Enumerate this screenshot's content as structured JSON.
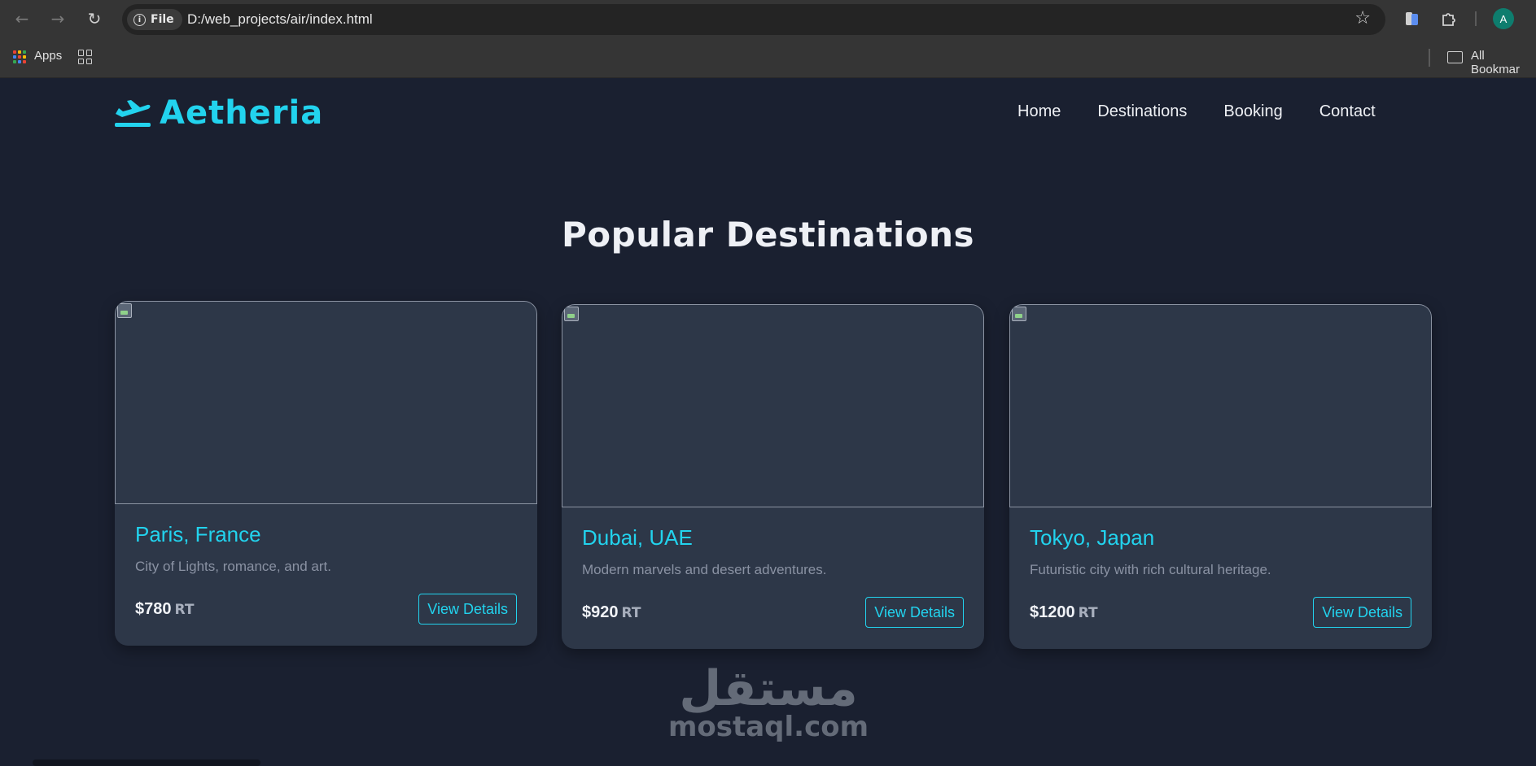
{
  "browser": {
    "file_chip": "File",
    "url": "D:/web_projects/air/index.html",
    "avatar_letter": "A",
    "bookmarks": {
      "apps_label": "Apps",
      "all_bookmarks_label": "All Bookmar"
    }
  },
  "site": {
    "logo_text": "Aetheria",
    "accent_color": "#22d3ee",
    "nav": [
      "Home",
      "Destinations",
      "Booking",
      "Contact"
    ],
    "section_title": "Popular Destinations",
    "cards": [
      {
        "title": "Paris, France",
        "description": "City of Lights, romance, and art.",
        "price": "$780",
        "price_suffix": "RT",
        "button": "View Details"
      },
      {
        "title": "Dubai, UAE",
        "description": "Modern marvels and desert adventures.",
        "price": "$920",
        "price_suffix": "RT",
        "button": "View Details"
      },
      {
        "title": "Tokyo, Japan",
        "description": "Futuristic city with rich cultural heritage.",
        "price": "$1200",
        "price_suffix": "RT",
        "button": "View Details"
      }
    ]
  },
  "watermark": {
    "arabic": "مستقل",
    "latin": "mostaql.com"
  }
}
